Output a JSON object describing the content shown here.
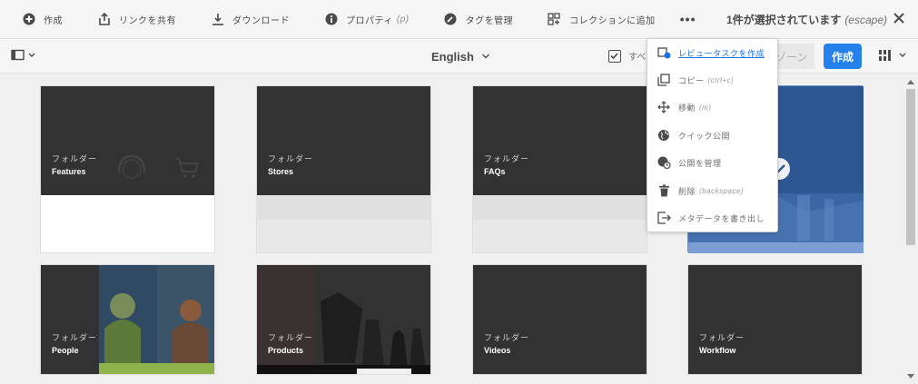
{
  "actionbar": {
    "items": [
      {
        "label": "作成",
        "hint": "",
        "icon": "plus-circle-icon"
      },
      {
        "label": "リンクを共有",
        "hint": "",
        "icon": "share-icon"
      },
      {
        "label": "ダウンロード",
        "hint": "",
        "icon": "download-icon"
      },
      {
        "label": "プロパティ",
        "hint": "(p)",
        "icon": "info-icon"
      },
      {
        "label": "タグを管理",
        "hint": "",
        "icon": "tag-icon"
      },
      {
        "label": "コレクションに追加",
        "hint": "",
        "icon": "collection-add-icon"
      }
    ],
    "more_label": "•••",
    "selection_text": "1件が選択されています",
    "selection_hint": "(escape)"
  },
  "toolbar2": {
    "language": "English",
    "select_all_label": "すべ",
    "zone_label": "ゾーン",
    "create_label": "作成"
  },
  "cards": [
    {
      "type": "フォルダー",
      "title": "Features"
    },
    {
      "type": "フォルダー",
      "title": "Stores"
    },
    {
      "type": "フォルダー",
      "title": "FAQs"
    },
    {
      "type": "",
      "title": ""
    },
    {
      "type": "フォルダー",
      "title": "People"
    },
    {
      "type": "フォルダー",
      "title": "Products"
    },
    {
      "type": "フォルダー",
      "title": "Videos"
    },
    {
      "type": "フォルダー",
      "title": "Workflow"
    }
  ],
  "menu": {
    "items": [
      {
        "label": "レビュータスクを作成",
        "shortcut": "",
        "icon": "review-task-icon"
      },
      {
        "label": "コピー",
        "shortcut": "(ctrl+c)",
        "icon": "copy-icon"
      },
      {
        "label": "移動",
        "shortcut": "(m)",
        "icon": "move-icon"
      },
      {
        "label": "クイック公開",
        "shortcut": "",
        "icon": "globe-icon"
      },
      {
        "label": "公開を管理",
        "shortcut": "",
        "icon": "globe-clock-icon"
      },
      {
        "label": "削除",
        "shortcut": "(backspace)",
        "icon": "trash-icon"
      },
      {
        "label": "メタデータを書き出し",
        "shortcut": "",
        "icon": "export-icon"
      }
    ]
  },
  "colors": {
    "accent": "#2680eb",
    "link": "#1473e6"
  }
}
